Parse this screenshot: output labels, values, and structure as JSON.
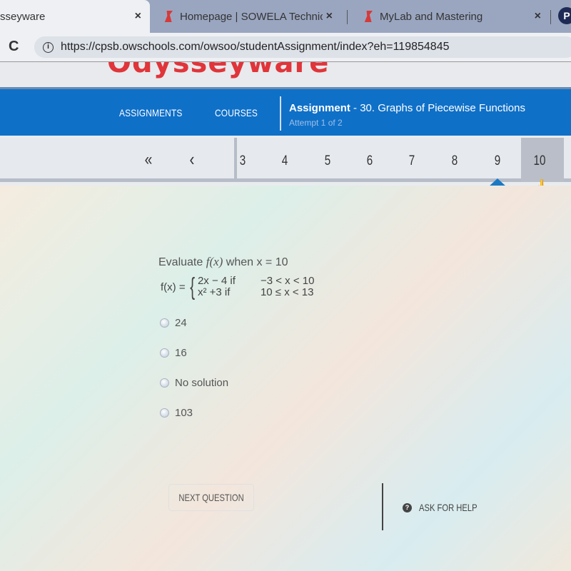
{
  "browser": {
    "tabs": [
      {
        "label": "sseyware",
        "active": true,
        "close": "×"
      },
      {
        "label": "Homepage | SOWELA Technical C",
        "active": false,
        "close": "×"
      },
      {
        "label": "MyLab and Mastering",
        "active": false,
        "close": "×"
      }
    ],
    "profile_initial": "P",
    "reload_icon": "C",
    "url": "https://cpsb.owschools.com/owsoo/studentAssignment/index?eh=119854845",
    "info_icon": "i"
  },
  "logo": "Odysseyware",
  "nav": {
    "assignments": "ASSIGNMENTS",
    "courses": "COURSES",
    "assignment_label": "Assignment",
    "assignment_title": " - 30. Graphs of Piecewise Functions",
    "attempt": "Attempt 1 of 2"
  },
  "pager": {
    "first": "«",
    "prev": "‹",
    "pages": [
      "3",
      "4",
      "5",
      "6",
      "7",
      "8",
      "9",
      "10"
    ],
    "current": "10",
    "marker_under": "9"
  },
  "question": {
    "prompt_pre": "Evaluate ",
    "prompt_fn": "f(x)",
    "prompt_post": " when x = 10",
    "lhs": "f(x) =",
    "brace": "{",
    "rows": [
      {
        "expr": "2x − 4 if",
        "cond": "−3 < x < 10"
      },
      {
        "expr": "x² +3 if",
        "cond": "10 ≤ x < 13"
      }
    ],
    "choices": [
      "24",
      "16",
      "No solution",
      "103"
    ]
  },
  "footer": {
    "next": "NEXT QUESTION",
    "help": "ASK FOR HELP",
    "help_icon": "?"
  },
  "colors": {
    "accent_blue": "#0f70c8",
    "logo_red": "#e0353a"
  }
}
